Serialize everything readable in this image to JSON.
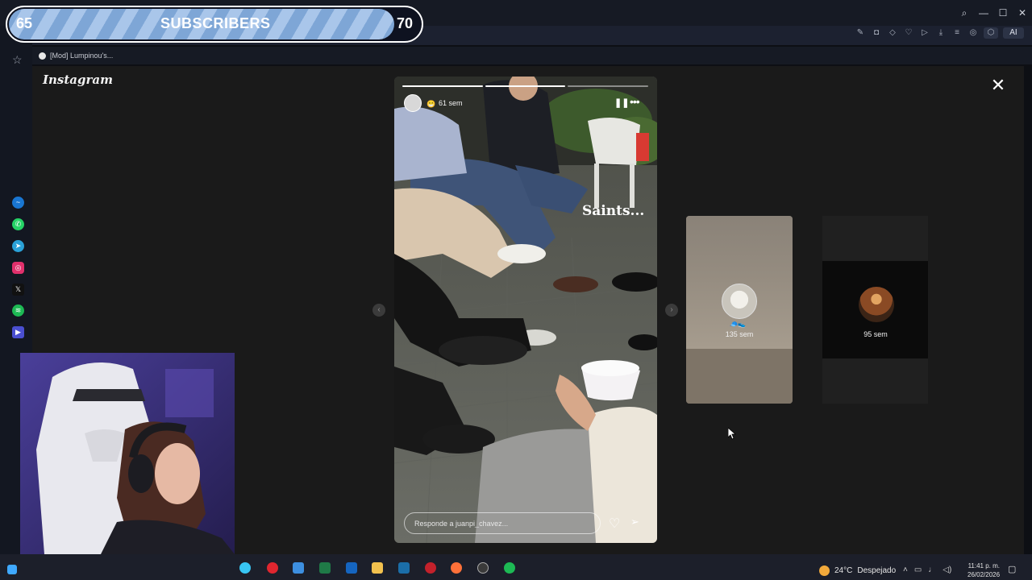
{
  "browser": {
    "tab_title": "[Mod] Lumpinou's...",
    "window_controls": [
      "search-icon",
      "minimize-icon",
      "maximize-icon",
      "close-icon"
    ],
    "toolbar_ai_label": "AI"
  },
  "instagram": {
    "logo": "Instagram",
    "story": {
      "time": "61 sem",
      "text_overlay": "Saints...",
      "reply_placeholder": "Responde a juanpi_chavez...",
      "progress_segments": 3,
      "progress_done": 2
    },
    "previews": [
      {
        "time": "135 sem"
      },
      {
        "time": "95 sem"
      }
    ]
  },
  "overlay": {
    "subs_current": "65",
    "subs_label": "SUBSCRIBERS",
    "subs_goal": "70",
    "subs_progress": 0.93
  },
  "taskbar": {
    "weather_temp": "24°C",
    "weather_desc": "Despejado",
    "time": "11:41 p. m.",
    "date": "26/02/2026"
  },
  "colors": {
    "accent": "#7ea6d6",
    "background": "#1a1a1a"
  }
}
